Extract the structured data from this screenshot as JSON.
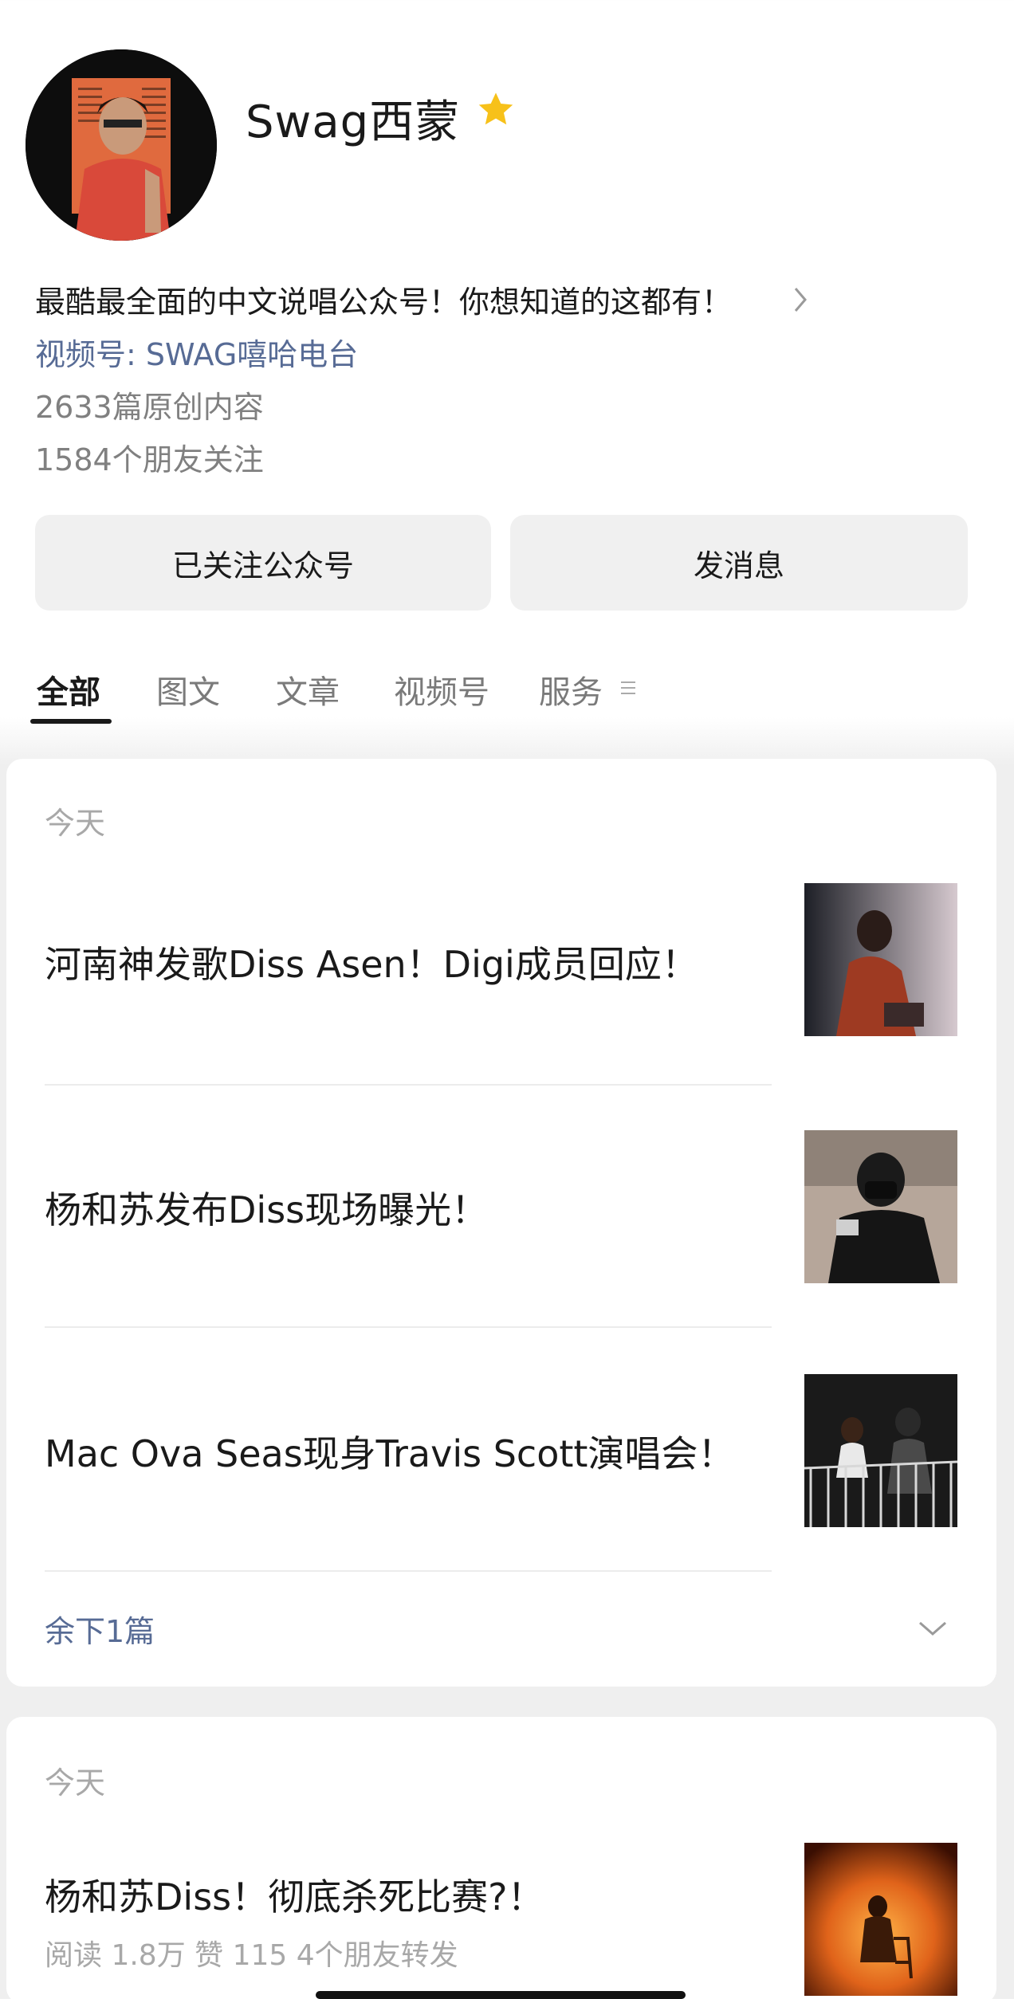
{
  "profile": {
    "name": "Swag西蒙",
    "description": "最酷最全面的中文说唱公众号！你想知道的这都有！",
    "channel": "视频号: SWAG嘻哈电台",
    "original_count": "2633篇原创内容",
    "friends_following": "1584个朋友关注"
  },
  "actions": {
    "followed_label": "已关注公众号",
    "message_label": "发消息"
  },
  "tabs": [
    {
      "label": "全部",
      "active": true
    },
    {
      "label": "图文",
      "active": false
    },
    {
      "label": "文章",
      "active": false
    },
    {
      "label": "视频号",
      "active": false
    },
    {
      "label": "服务",
      "active": false
    }
  ],
  "groups": [
    {
      "date": "今天",
      "articles": [
        {
          "title": "河南神发歌Diss Asen！Digi成员回应！"
        },
        {
          "title": "杨和苏发布Diss现场曝光！"
        },
        {
          "title": "Mac Ova Seas现身Travis Scott演唱会！"
        }
      ],
      "more": "余下1篇"
    },
    {
      "date": "今天",
      "articles": [
        {
          "title": "杨和苏Diss！彻底杀死比赛?！",
          "meta": "阅读 1.8万   赞 115   4个朋友转发"
        }
      ]
    }
  ],
  "icons": {
    "star": "star-icon",
    "desc_more": "chevron-right-icon",
    "tab_more": "menu-icon",
    "expand": "chevron-down-icon"
  },
  "colors": {
    "link": "#576b95",
    "star": "#f7c11a",
    "muted": "#a8a8a8"
  }
}
